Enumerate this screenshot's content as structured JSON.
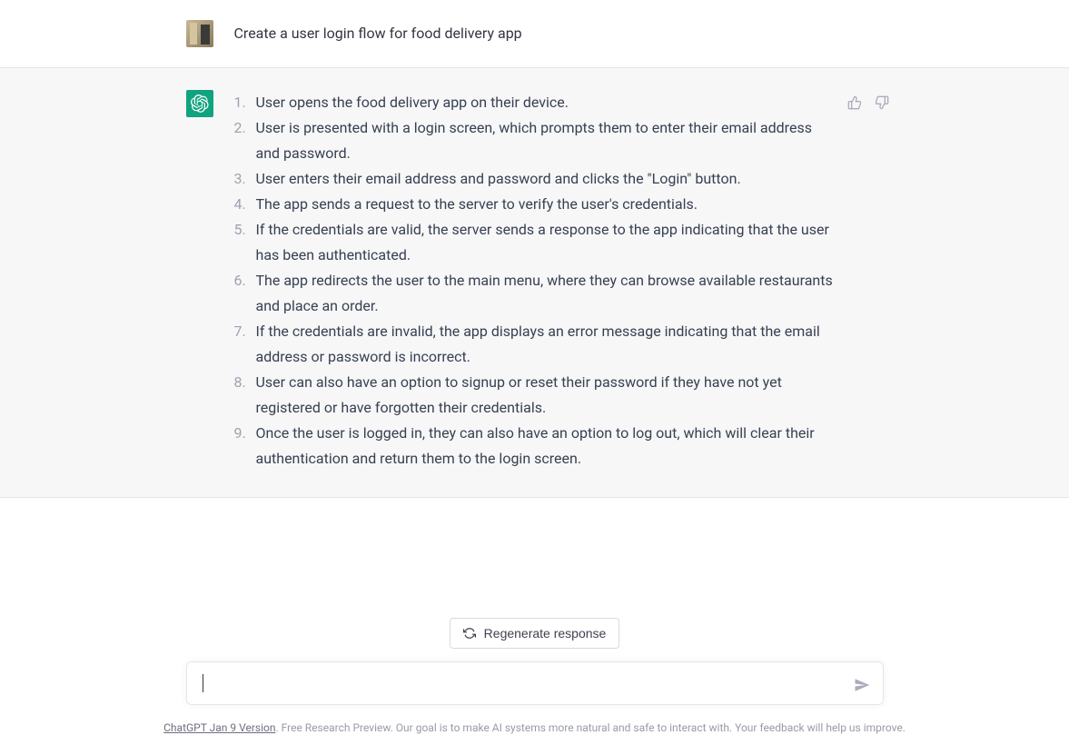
{
  "user_message": "Create a user login flow for food delivery app",
  "assistant_response": {
    "steps": [
      "User opens the food delivery app on their device.",
      "User is presented with a login screen, which prompts them to enter their email address and password.",
      "User enters their email address and password and clicks the \"Login\" button.",
      "The app sends a request to the server to verify the user's credentials.",
      "If the credentials are valid, the server sends a response to the app indicating that the user has been authenticated.",
      "The app redirects the user to the main menu, where they can browse available restaurants and place an order.",
      "If the credentials are invalid, the app displays an error message indicating that the email address or password is incorrect.",
      "User can also have an option to signup or reset their password if they have not yet registered or have forgotten their credentials.",
      "Once the user is logged in, they can also have an option to log out, which will clear their authentication and return them to the login screen."
    ]
  },
  "controls": {
    "regenerate_label": "Regenerate response",
    "input_value": ""
  },
  "footer": {
    "version_link": "ChatGPT Jan 9 Version",
    "disclaimer_text": ". Free Research Preview. Our goal is to make AI systems more natural and safe to interact with. Your feedback will help us improve."
  }
}
